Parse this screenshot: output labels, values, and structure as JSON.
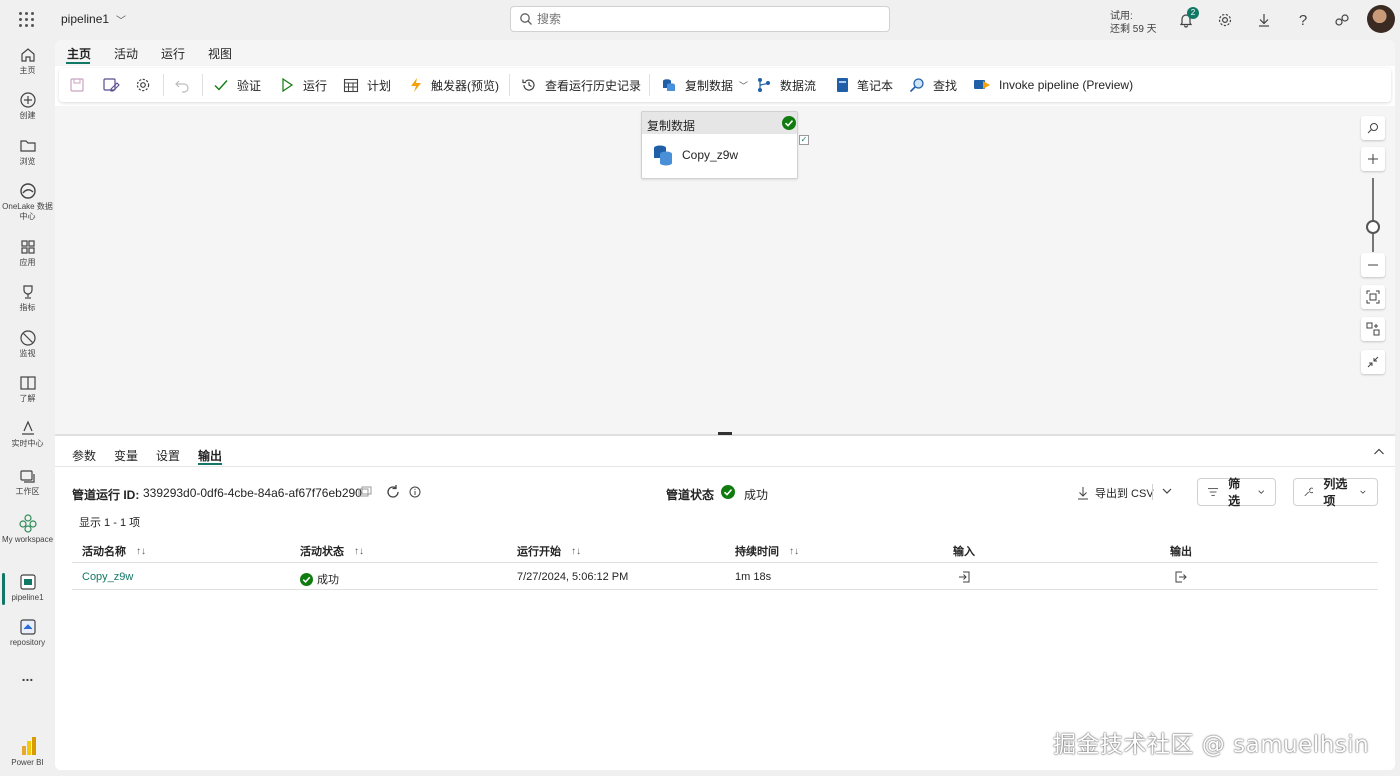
{
  "topbar": {
    "workspace_item": "pipeline1",
    "search_placeholder": "搜索",
    "trial_label": "试用:",
    "trial_remaining": "还剩 59 天",
    "notification_count": "2"
  },
  "rail": {
    "items": [
      {
        "label": "主页",
        "icon": "home-icon"
      },
      {
        "label": "创建",
        "icon": "create-icon"
      },
      {
        "label": "浏览",
        "icon": "folder-icon"
      },
      {
        "label": "OneLake 数据中心",
        "icon": "onelake-icon"
      },
      {
        "label": "应用",
        "icon": "apps-icon"
      },
      {
        "label": "指标",
        "icon": "trophy-icon"
      },
      {
        "label": "监视",
        "icon": "monitor-icon"
      },
      {
        "label": "了解",
        "icon": "book-icon"
      },
      {
        "label": "实时中心",
        "icon": "realtime-icon"
      },
      {
        "label": "工作区",
        "icon": "workspaces-icon"
      },
      {
        "label": "My workspace",
        "icon": "my-workspace-icon"
      },
      {
        "label": "pipeline1",
        "icon": "pipeline-icon"
      },
      {
        "label": "repository",
        "icon": "repository-icon"
      },
      {
        "label": "...",
        "icon": "more-icon"
      },
      {
        "label": "Power BI",
        "icon": "powerbi-icon"
      }
    ]
  },
  "tabs": [
    "主页",
    "活动",
    "运行",
    "视图"
  ],
  "toolbar": {
    "validate": "验证",
    "run": "运行",
    "schedule": "计划",
    "trigger": "触发器(预览)",
    "history": "查看运行历史记录",
    "copy_data": "复制数据",
    "dataflow": "数据流",
    "notebook": "笔记本",
    "lookup": "查找",
    "invoke": "Invoke pipeline (Preview)"
  },
  "canvas": {
    "activity_type": "复制数据",
    "activity_name": "Copy_z9w"
  },
  "bottom": {
    "tabs": [
      "参数",
      "变量",
      "设置",
      "输出"
    ],
    "run_id_label": "管道运行 ID:",
    "run_id": "339293d0-0df6-4cbe-84a6-af67f76eb290",
    "pipeline_status_label": "管道状态",
    "pipeline_status": "成功",
    "export": "导出到 CSV",
    "filter": "筛选",
    "column_options": "列选项",
    "showing": "显示 1 - 1 项",
    "columns": [
      "活动名称",
      "活动状态",
      "运行开始",
      "持续时间",
      "输入",
      "输出"
    ],
    "rows": [
      {
        "name": "Copy_z9w",
        "status": "成功",
        "start": "7/27/2024, 5:06:12 PM",
        "duration": "1m 18s"
      }
    ]
  },
  "watermark": "掘金技术社区 @ samuelhsin",
  "colors": {
    "accent": "#117865",
    "success": "#107c10",
    "canvas_bg": "#f5f5f5"
  }
}
